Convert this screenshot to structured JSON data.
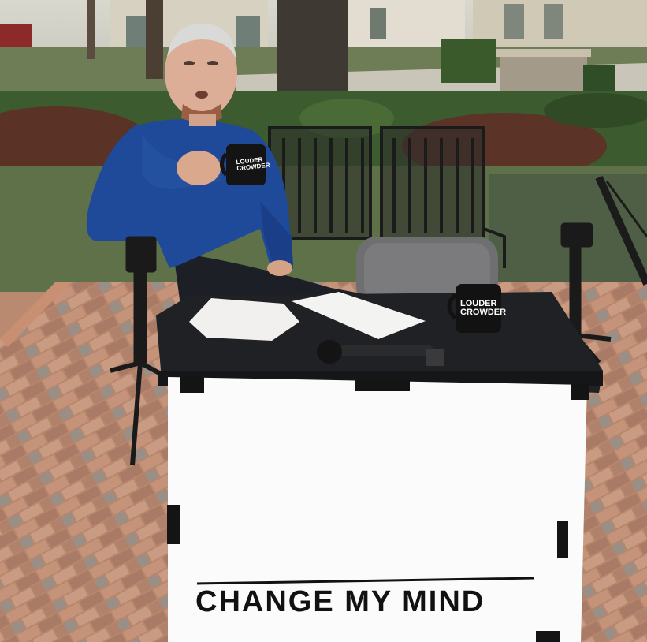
{
  "sign": {
    "text": "CHANGE MY MIND"
  },
  "mug_held": {
    "line1": "LOUDER",
    "line2": "CROWDER"
  },
  "mug_desk": {
    "line1": "LOUDER",
    "line2": "CROWDER"
  }
}
